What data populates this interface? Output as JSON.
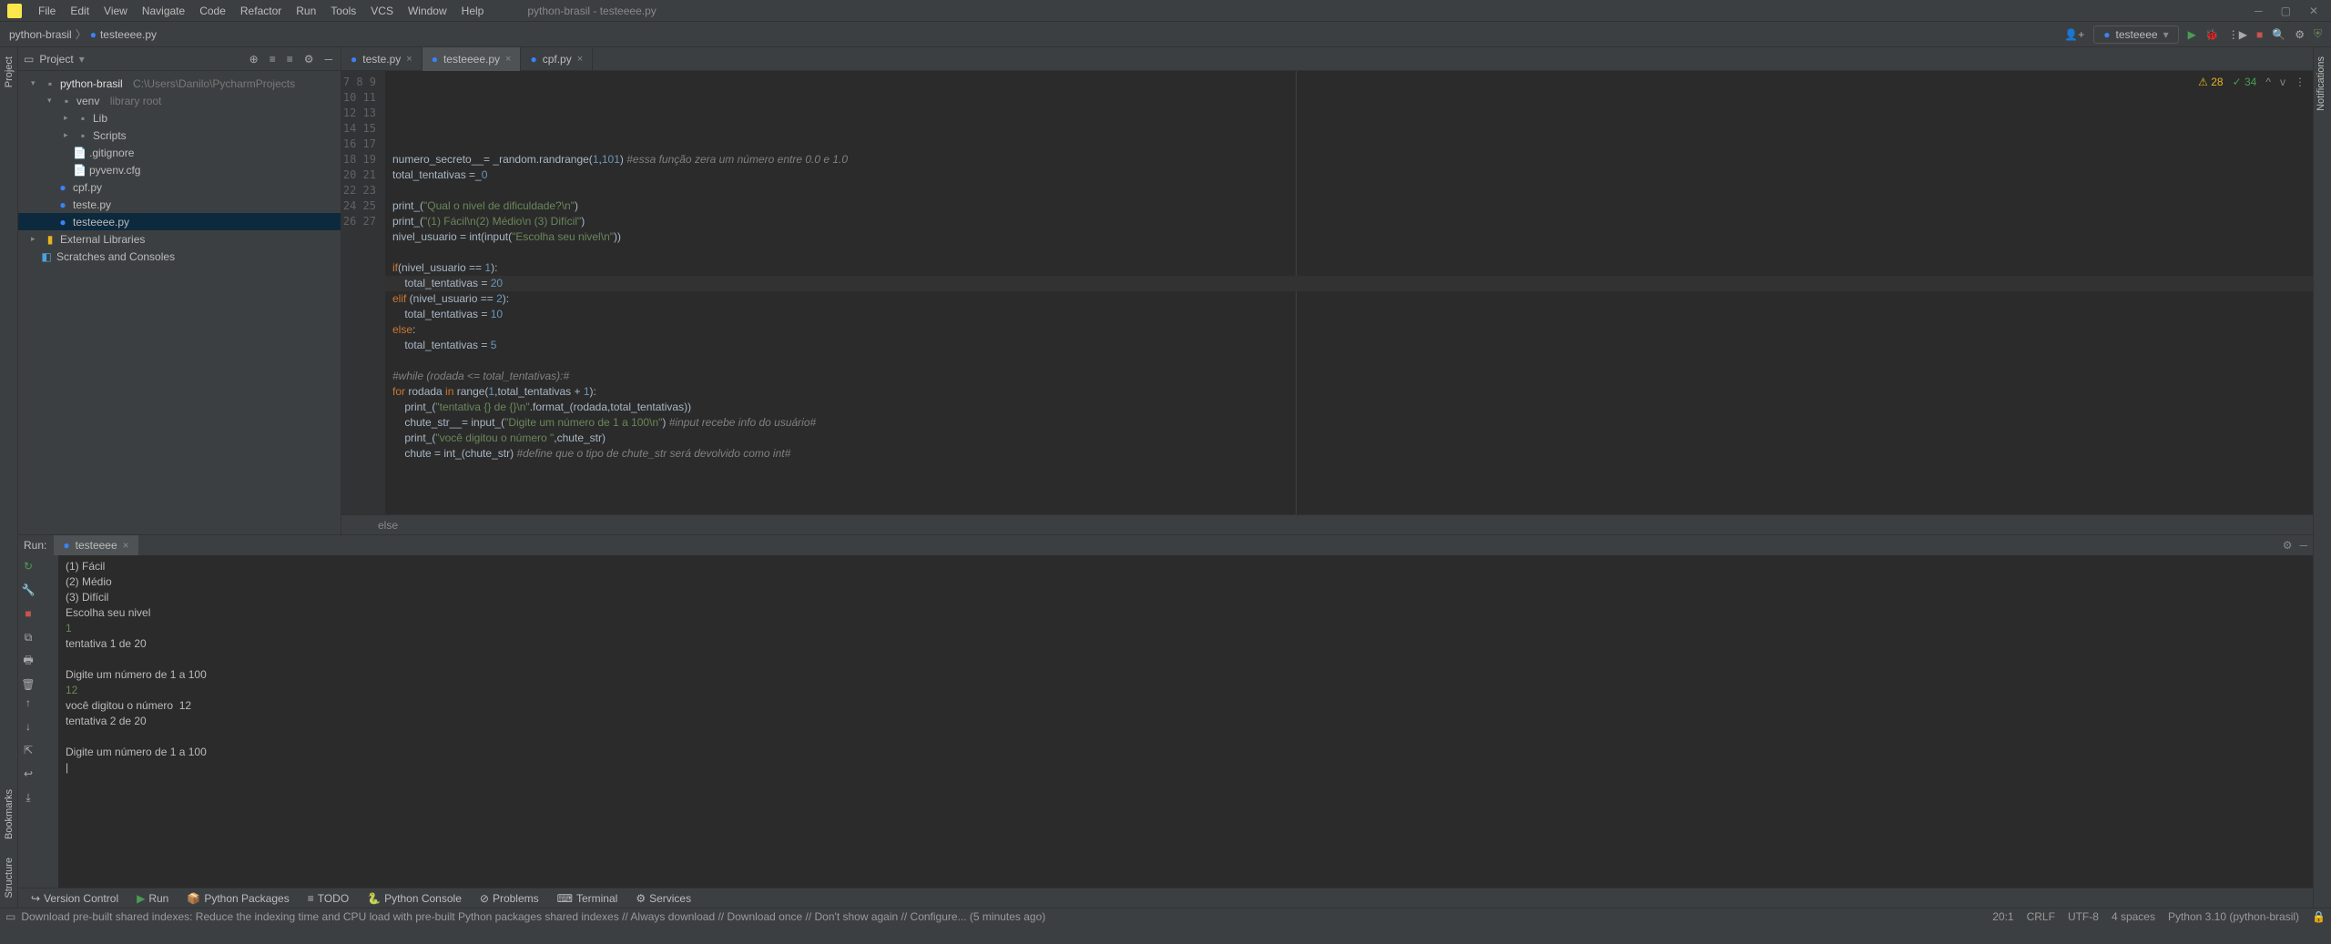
{
  "menu": [
    "File",
    "Edit",
    "View",
    "Navigate",
    "Code",
    "Refactor",
    "Run",
    "Tools",
    "VCS",
    "Window",
    "Help"
  ],
  "window_title": "python-brasil - testeeee.py",
  "breadcrumb": {
    "root": "python-brasil",
    "file": "testeeee.py"
  },
  "run_config": {
    "name": "testeeee"
  },
  "project_header": {
    "label": "Project"
  },
  "tree": {
    "project": "python-brasil",
    "project_path": "C:\\Users\\Danilo\\PycharmProjects",
    "venv": "venv",
    "venv_hint": "library root",
    "lib": "Lib",
    "scripts": "Scripts",
    "gitignore": ".gitignore",
    "pyvenv": "pyvenv.cfg",
    "cpf": "cpf.py",
    "teste": "teste.py",
    "testeeee": "testeeee.py",
    "ext_lib": "External Libraries",
    "scratches": "Scratches and Consoles"
  },
  "editor_tabs": [
    {
      "label": "teste.py",
      "active": false
    },
    {
      "label": "testeeee.py",
      "active": true
    },
    {
      "label": "cpf.py",
      "active": false
    }
  ],
  "gutter_start": 7,
  "gutter_end": 27,
  "code_lines": [
    {
      "t": [
        "numero_secreto__= _random.randrange(",
        "1",
        ",",
        "101",
        ") ",
        "#essa função zera um número entre 0.0 e 1.0"
      ],
      "c": [
        "",
        "num",
        "",
        "num",
        "",
        "com"
      ]
    },
    {
      "t": [
        "total_tentativas =_",
        "0"
      ],
      "c": [
        "",
        "num"
      ]
    },
    {
      "t": [
        ""
      ],
      "c": [
        ""
      ]
    },
    {
      "t": [
        "print_(",
        "\"Qual o nivel de dificuldade?",
        "\\n\"",
        ")"
      ],
      "c": [
        "",
        "str",
        "str",
        ""
      ]
    },
    {
      "t": [
        "print_(",
        "\"(1) Fácil",
        "\\n",
        "(2) Médio",
        "\\n (3) Difícil\"",
        ")"
      ],
      "c": [
        "",
        "str",
        "str",
        "str",
        "str",
        ""
      ]
    },
    {
      "t": [
        "nivel_usuario = int(input(",
        "\"Escolha seu nivel",
        "\\n\"",
        "))"
      ],
      "c": [
        "",
        "str",
        "str",
        ""
      ]
    },
    {
      "t": [
        ""
      ],
      "c": [
        ""
      ]
    },
    {
      "t": [
        "if",
        "(nivel_usuario == ",
        "1",
        "):"
      ],
      "c": [
        "kw",
        "",
        "num",
        ""
      ]
    },
    {
      "t": [
        "    total_tentativas = ",
        "20"
      ],
      "c": [
        "",
        "num"
      ]
    },
    {
      "t": [
        "elif",
        " (nivel_usuario == ",
        "2",
        "):"
      ],
      "c": [
        "kw",
        "",
        "num",
        ""
      ]
    },
    {
      "t": [
        "    total_tentativas = ",
        "10"
      ],
      "c": [
        "",
        "num"
      ]
    },
    {
      "t": [
        "else",
        ":"
      ],
      "c": [
        "kw",
        ""
      ]
    },
    {
      "t": [
        "    total_tentativas = ",
        "5"
      ],
      "c": [
        "",
        "num"
      ]
    },
    {
      "t": [
        ""
      ],
      "c": [
        ""
      ]
    },
    {
      "t": [
        "#while (rodada <= total_tentativas):#"
      ],
      "c": [
        "com"
      ]
    },
    {
      "t": [
        "for ",
        "rodada ",
        "in ",
        "range(",
        "1",
        ",total_tentativas + ",
        "1",
        "):"
      ],
      "c": [
        "kw",
        "",
        "kw",
        "",
        "num",
        "",
        "num",
        ""
      ]
    },
    {
      "t": [
        "    print_(",
        "\"tentativa {} de {}",
        "\\n\"",
        ".format_(rodada,total_tentativas))"
      ],
      "c": [
        "",
        "str",
        "str",
        ""
      ]
    },
    {
      "t": [
        "    chute_str__= input_(",
        "\"Digite um número de 1 a 100",
        "\\n\"",
        ") ",
        "#input recebe info do usuário#"
      ],
      "c": [
        "",
        "str",
        "str",
        "",
        "com"
      ]
    },
    {
      "t": [
        "    print_(",
        "\"você digitou o número \"",
        ",chute_str)"
      ],
      "c": [
        "",
        "str",
        ""
      ]
    },
    {
      "t": [
        "    chute = int_(chute_str) ",
        "#define que o tipo de chute_str será devolvido como int#"
      ],
      "c": [
        "",
        "com"
      ]
    }
  ],
  "warnings": {
    "yellow": "28",
    "green": "34"
  },
  "crumb_strip": "else",
  "run_label": "Run:",
  "run_tab": "testeeee",
  "console_lines": [
    {
      "t": "(1) Fácil",
      "c": ""
    },
    {
      "t": "(2) Médio",
      "c": ""
    },
    {
      "t": "(3) Difícil",
      "c": ""
    },
    {
      "t": "Escolha seu nivel",
      "c": ""
    },
    {
      "t": "1",
      "c": "input-green"
    },
    {
      "t": "tentativa 1 de 20",
      "c": ""
    },
    {
      "t": "",
      "c": ""
    },
    {
      "t": "Digite um número de 1 a 100",
      "c": ""
    },
    {
      "t": "12",
      "c": "input-green"
    },
    {
      "t": "você digitou o número  12",
      "c": ""
    },
    {
      "t": "tentativa 2 de 20",
      "c": ""
    },
    {
      "t": "",
      "c": ""
    },
    {
      "t": "Digite um número de 1 a 100",
      "c": ""
    }
  ],
  "tool_windows": [
    "Version Control",
    "Run",
    "Python Packages",
    "TODO",
    "Python Console",
    "Problems",
    "Terminal",
    "Services"
  ],
  "status": {
    "msg": "Download pre-built shared indexes: Reduce the indexing time and CPU load with pre-built Python packages shared indexes // Always download // Download once // Don't show again // Configure... (5 minutes ago)",
    "caret": "20:1",
    "eol": "CRLF",
    "enc": "UTF-8",
    "indent": "4 spaces",
    "interp": "Python 3.10 (python-brasil)"
  },
  "rails": {
    "project": "Project",
    "bookmarks": "Bookmarks",
    "structure": "Structure",
    "notifications": "Notifications"
  }
}
